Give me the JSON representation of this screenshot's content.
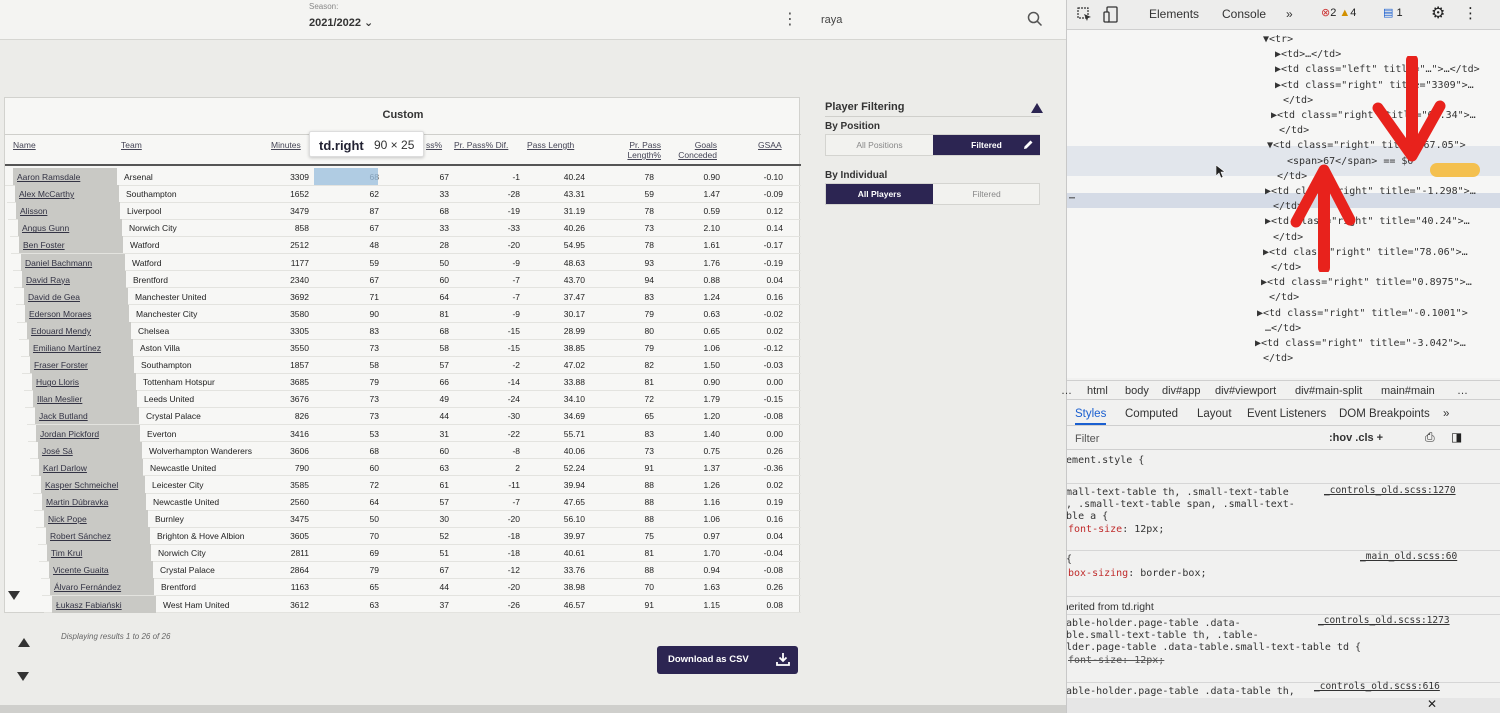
{
  "app": {
    "season_label": "Season:",
    "season_value": "2021/2022 ⌄",
    "search_value": "raya",
    "card_title": "Custom",
    "columns": [
      "Name",
      "Team",
      "Minutes",
      "ss%",
      "Pr. Pass% Dif.",
      "Pass Length",
      "Pr. Pass Length%",
      "Goals Conceded",
      "GSAA"
    ],
    "rows": [
      [
        "Aaron Ramsdale",
        "Arsenal",
        "3309",
        "68",
        "67",
        "-1",
        "40.24",
        "78",
        "0.90",
        "-0.10"
      ],
      [
        "Alex McCarthy",
        "Southampton",
        "1652",
        "62",
        "33",
        "-28",
        "43.31",
        "59",
        "1.47",
        "-0.09"
      ],
      [
        "Alisson",
        "Liverpool",
        "3479",
        "87",
        "68",
        "-19",
        "31.19",
        "78",
        "0.59",
        "0.12"
      ],
      [
        "Angus Gunn",
        "Norwich City",
        "858",
        "67",
        "33",
        "-33",
        "40.26",
        "73",
        "2.10",
        "0.14"
      ],
      [
        "Ben Foster",
        "Watford",
        "2512",
        "48",
        "28",
        "-20",
        "54.95",
        "78",
        "1.61",
        "-0.17"
      ],
      [
        "Daniel Bachmann",
        "Watford",
        "1177",
        "59",
        "50",
        "-9",
        "48.63",
        "93",
        "1.76",
        "-0.19"
      ],
      [
        "David Raya",
        "Brentford",
        "2340",
        "67",
        "60",
        "-7",
        "43.70",
        "94",
        "0.88",
        "0.04"
      ],
      [
        "David de Gea",
        "Manchester United",
        "3692",
        "71",
        "64",
        "-7",
        "37.47",
        "83",
        "1.24",
        "0.16"
      ],
      [
        "Ederson Moraes",
        "Manchester City",
        "3580",
        "90",
        "81",
        "-9",
        "30.17",
        "79",
        "0.63",
        "-0.02"
      ],
      [
        "Edouard Mendy",
        "Chelsea",
        "3305",
        "83",
        "68",
        "-15",
        "28.99",
        "80",
        "0.65",
        "0.02"
      ],
      [
        "Emiliano Martínez",
        "Aston Villa",
        "3550",
        "73",
        "58",
        "-15",
        "38.85",
        "79",
        "1.06",
        "-0.12"
      ],
      [
        "Fraser Forster",
        "Southampton",
        "1857",
        "58",
        "57",
        "-2",
        "47.02",
        "82",
        "1.50",
        "-0.03"
      ],
      [
        "Hugo Lloris",
        "Tottenham Hotspur",
        "3685",
        "79",
        "66",
        "-14",
        "33.88",
        "81",
        "0.90",
        "0.00"
      ],
      [
        "Illan Meslier",
        "Leeds United",
        "3676",
        "73",
        "49",
        "-24",
        "34.10",
        "72",
        "1.79",
        "-0.15"
      ],
      [
        "Jack Butland",
        "Crystal Palace",
        "826",
        "73",
        "44",
        "-30",
        "34.69",
        "65",
        "1.20",
        "-0.08"
      ],
      [
        "Jordan Pickford",
        "Everton",
        "3416",
        "53",
        "31",
        "-22",
        "55.71",
        "83",
        "1.40",
        "0.00"
      ],
      [
        "José Sá",
        "Wolverhampton Wanderers",
        "3606",
        "68",
        "60",
        "-8",
        "40.06",
        "73",
        "0.75",
        "0.26"
      ],
      [
        "Karl Darlow",
        "Newcastle United",
        "790",
        "60",
        "63",
        "2",
        "52.24",
        "91",
        "1.37",
        "-0.36"
      ],
      [
        "Kasper Schmeichel",
        "Leicester City",
        "3585",
        "72",
        "61",
        "-11",
        "39.94",
        "88",
        "1.26",
        "0.02"
      ],
      [
        "Martin Dúbravka",
        "Newcastle United",
        "2560",
        "64",
        "57",
        "-7",
        "47.65",
        "88",
        "1.16",
        "0.19"
      ],
      [
        "Nick Pope",
        "Burnley",
        "3475",
        "50",
        "30",
        "-20",
        "56.10",
        "88",
        "1.06",
        "0.16"
      ],
      [
        "Robert Sánchez",
        "Brighton & Hove Albion",
        "3605",
        "70",
        "52",
        "-18",
        "39.97",
        "75",
        "0.97",
        "0.04"
      ],
      [
        "Tim Krul",
        "Norwich City",
        "2811",
        "69",
        "51",
        "-18",
        "40.61",
        "81",
        "1.70",
        "-0.04"
      ],
      [
        "Vicente Guaita",
        "Crystal Palace",
        "2864",
        "79",
        "67",
        "-12",
        "33.76",
        "88",
        "0.94",
        "-0.08"
      ],
      [
        "Álvaro Fernández",
        "Brentford",
        "1163",
        "65",
        "44",
        "-20",
        "38.98",
        "70",
        "1.63",
        "0.26"
      ],
      [
        "Łukasz Fabiański",
        "West Ham United",
        "3612",
        "63",
        "37",
        "-26",
        "46.57",
        "91",
        "1.15",
        "0.08"
      ]
    ],
    "tooltip": {
      "name": "td.right",
      "size": "90 × 25"
    },
    "footer": "Displaying results 1 to 26 of 26",
    "csv_button": "Download as CSV",
    "filter": {
      "title": "Player Filtering",
      "by_position": "By Position",
      "pos_all": "All Positions",
      "pos_filtered": "Filtered",
      "by_individual": "By Individual",
      "ind_all": "All Players",
      "ind_filtered": "Filtered"
    },
    "colors": {
      "accent": "#2c2552",
      "highlight": "#9ec0df"
    }
  },
  "devtools": {
    "tabs": [
      "Elements",
      "Console",
      "»"
    ],
    "badges": {
      "errors": "2",
      "warnings": "4",
      "messages": "1"
    },
    "tree": [
      "▼<tr>",
      "▶<td>…</td>",
      "▶<td class=\"left\" title=\"…\">…</td>",
      "▶<td class=\"right\" title=\"3309\">…",
      "</td>",
      "▶<td class=\"right\" title=\"68.34\">…",
      "</td>",
      "▼<td class=\"right\" title=\"67.05\">",
      "<span>67</span> == $0",
      "</td>",
      "▶<td class=\"right\" title=\"-1.298\">…",
      "</td>",
      "▶<td class=\"right\" title=\"40.24\">…",
      "</td>",
      "▶<td class=\"right\" title=\"78.06\">…",
      "</td>",
      "▶<td class=\"right\" title=\"0.8975\">…",
      "</td>",
      "▶<td class=\"right\" title=\"-0.1001\">",
      "…</td>",
      "▶<td class=\"right\" title=\"-3.042\">…",
      "</td>"
    ],
    "crumbs": [
      "…",
      "html",
      "body",
      "div#app",
      "div#viewport",
      "div#main-split",
      "main#main",
      "…"
    ],
    "subtabs": [
      "Styles",
      "Computed",
      "Layout",
      "Event Listeners",
      "DOM Breakpoints",
      "»"
    ],
    "filter_placeholder": "Filter",
    "filter_tools": ":hov .cls +",
    "styles": {
      "element_style": "element.style {",
      "close": "}",
      "rule1_selector_a": ".small-text-table th, .small-text-table",
      "rule1_selector_b": "td, .small-text-table span, .small-text-",
      "rule1_selector_c": "table a {",
      "rule1_src": "_controls_old.scss:1270",
      "rule1_prop": "font-size",
      "rule1_val": "12px;",
      "rule2_selector": "* {",
      "rule2_src": "_main_old.scss:60",
      "rule2_prop": "box-sizing",
      "rule2_val": "border-box;",
      "inherited": "Inherited from",
      "inherited_el": "td.right",
      "rule3_selector_a": ".table-holder.page-table .data-",
      "rule3_selector_b": "table.small-text-table th, .table-",
      "rule3_selector_c": "holder.page-table .data-table.small-text-table td {",
      "rule3_src": "_controls_old.scss:1273",
      "rule3_prop": "font-size: 12px;",
      "rule4_selector": ".table-holder.page-table .data-table th,",
      "rule4_src": "_controls_old.scss:616"
    }
  }
}
